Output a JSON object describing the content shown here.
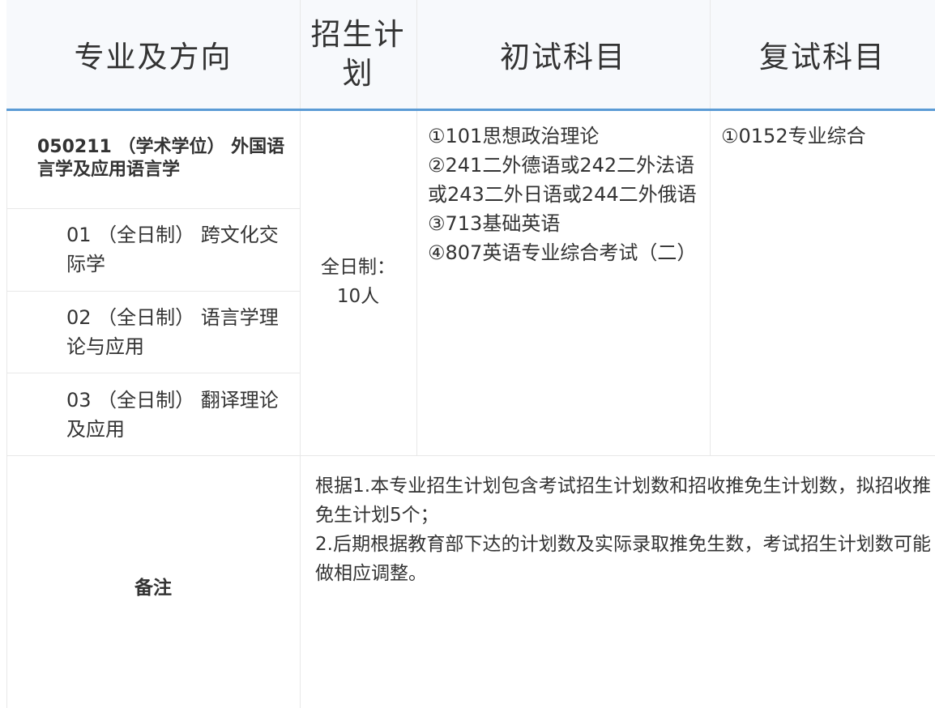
{
  "header": {
    "major": "专业及方向",
    "plan_line1": "招生计",
    "plan_line2": "划",
    "initial_exam": "初试科目",
    "retest": "复试科目"
  },
  "degree": "050211 （学术学位） 外国语言学及应用语言学",
  "directions": [
    {
      "text": "01 （全日制） 跨文化交际学"
    },
    {
      "text": "02 （全日制） 语言学理论与应用"
    },
    {
      "text": "03 （全日制） 翻译理论及应用"
    }
  ],
  "plan": {
    "line1": "全日制：",
    "line2": "10人"
  },
  "initial_exams": [
    "①101思想政治理论",
    "②241二外德语或242二外法语或243二外日语或244二外俄语",
    "③713基础英语",
    "④807英语专业综合考试（二）"
  ],
  "retest_subject": "①0152专业综合",
  "remarks": {
    "label": "备注",
    "line1": "根据1.本专业招生计划包含考试招生计划数和招收推免生计划数，拟招收推免生计划5个；",
    "line2": "2.后期根据教育部下达的计划数及实际录取推免生数，考试招生计划数可能做相应调整。"
  }
}
